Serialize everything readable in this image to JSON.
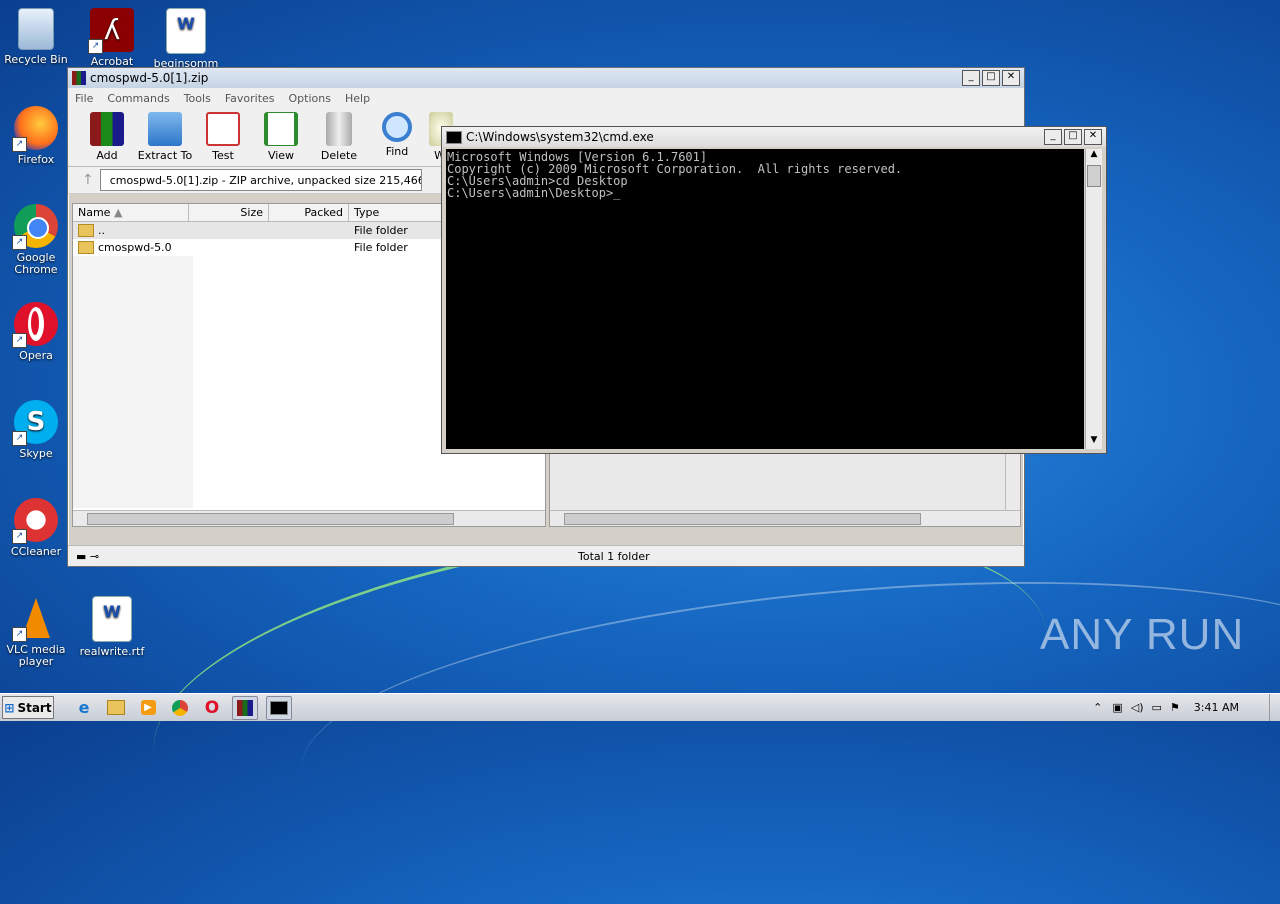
{
  "desktop": {
    "icons": [
      {
        "label": "Recycle Bin"
      },
      {
        "label": "Acrobat"
      },
      {
        "label": "beginsomm"
      },
      {
        "label": "Firefox"
      },
      {
        "label": "Google Chrome"
      },
      {
        "label": "Opera"
      },
      {
        "label": "Skype"
      },
      {
        "label": "CCleaner"
      },
      {
        "label": "VLC media player"
      },
      {
        "label": "realwrite.rtf"
      }
    ],
    "watermark": "ANY RUN"
  },
  "winrar": {
    "title": "cmospwd-5.0[1].zip",
    "menu": [
      "File",
      "Commands",
      "Tools",
      "Favorites",
      "Options",
      "Help"
    ],
    "toolbar": [
      "Add",
      "Extract To",
      "Test",
      "View",
      "Delete",
      "Find",
      "Wi"
    ],
    "address": "cmospwd-5.0[1].zip - ZIP archive, unpacked size 215,466 byt",
    "columns": [
      "Name",
      "Size",
      "Packed",
      "Type"
    ],
    "rows": [
      {
        "name": "..",
        "type": "File folder"
      },
      {
        "name": "cmospwd-5.0",
        "type": "File folder"
      }
    ],
    "status": "Total 1 folder"
  },
  "cmd": {
    "title": "C:\\Windows\\system32\\cmd.exe",
    "lines": [
      "Microsoft Windows [Version 6.1.7601]",
      "Copyright (c) 2009 Microsoft Corporation.  All rights reserved.",
      "",
      "C:\\Users\\admin>cd Desktop",
      "",
      "C:\\Users\\admin\\Desktop>_"
    ]
  },
  "taskbar": {
    "start_label": "Start",
    "time": "3:41 AM"
  },
  "window_buttons": {
    "min": "_",
    "max": "□",
    "close": "✕"
  }
}
